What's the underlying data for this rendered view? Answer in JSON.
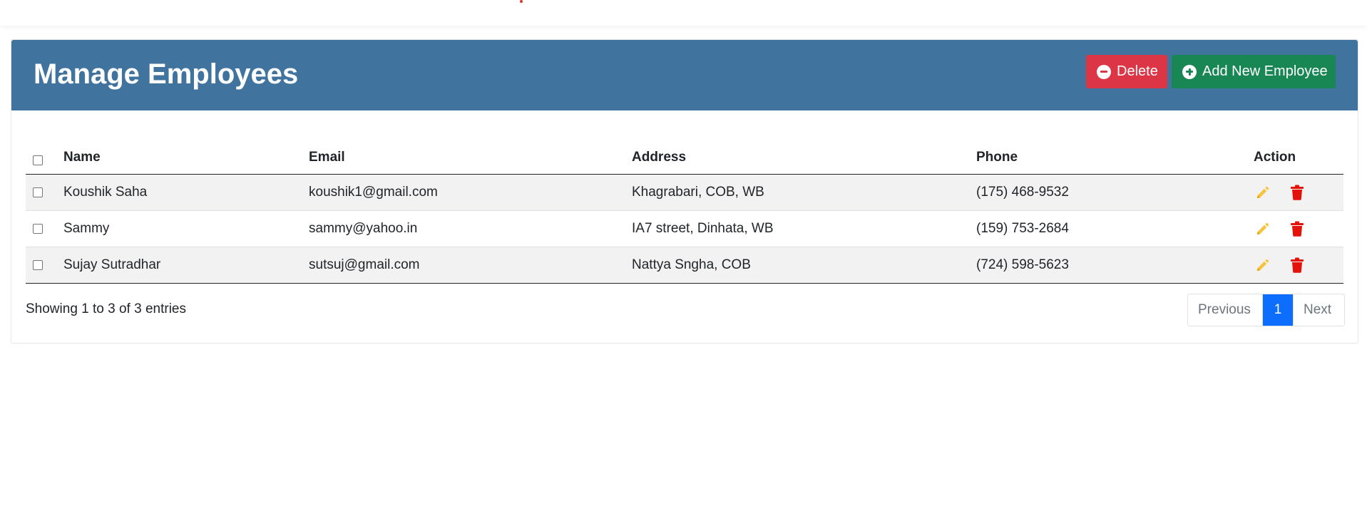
{
  "header": {
    "title": "Manage Employees",
    "delete_label": "Delete",
    "add_label": "Add New Employee"
  },
  "colors": {
    "header_bg": "#40739e",
    "delete": "#dc3545",
    "add": "#198754",
    "edit_icon": "#f5c542",
    "trash_icon": "#e3120b",
    "active_page": "#0d6efd"
  },
  "table": {
    "columns": [
      "Name",
      "Email",
      "Address",
      "Phone",
      "Action"
    ],
    "rows": [
      {
        "name": "Koushik Saha",
        "email": "koushik1@gmail.com",
        "address": "Khagrabari, COB, WB",
        "phone": "(175) 468-9532"
      },
      {
        "name": "Sammy",
        "email": "sammy@yahoo.in",
        "address": "IA7 street, Dinhata, WB",
        "phone": "(159) 753-2684"
      },
      {
        "name": "Sujay Sutradhar",
        "email": "sutsuj@gmail.com",
        "address": "Nattya Sngha, COB",
        "phone": "(724) 598-5623"
      }
    ],
    "action_icons": [
      "pencil-icon",
      "trash-icon"
    ]
  },
  "footer": {
    "info": "Showing 1 to 3 of 3 entries",
    "pagination": {
      "previous": "Previous",
      "current": "1",
      "next": "Next"
    }
  }
}
